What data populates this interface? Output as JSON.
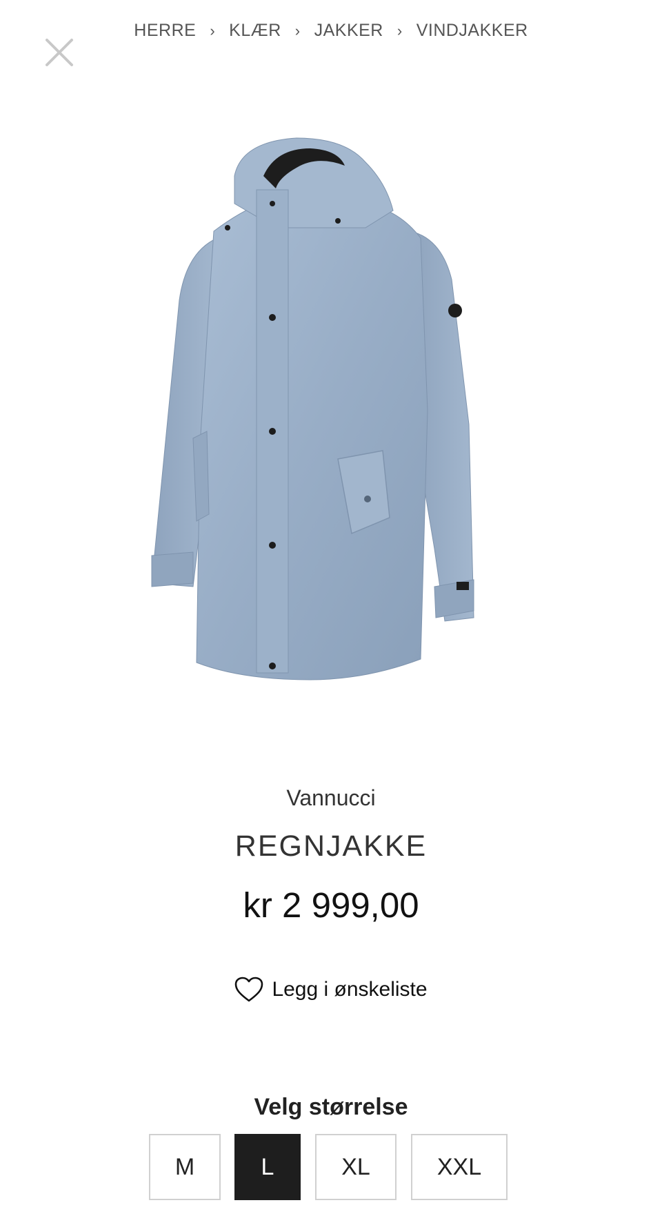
{
  "breadcrumb": {
    "items": [
      "HERRE",
      "KLÆR",
      "JAKKER",
      "VINDJAKKER"
    ]
  },
  "product": {
    "brand": "Vannucci",
    "name": "REGNJAKKE",
    "price": "kr 2 999,00",
    "image_icon": "raincoat-product-image",
    "color": "#98adc6"
  },
  "wishlist": {
    "label": "Legg i ønskeliste",
    "icon": "heart-icon"
  },
  "sizes": {
    "heading": "Velg størrelse",
    "options": [
      "M",
      "L",
      "XL",
      "XXL"
    ],
    "selected": "L"
  },
  "close": {
    "icon": "close-icon"
  }
}
